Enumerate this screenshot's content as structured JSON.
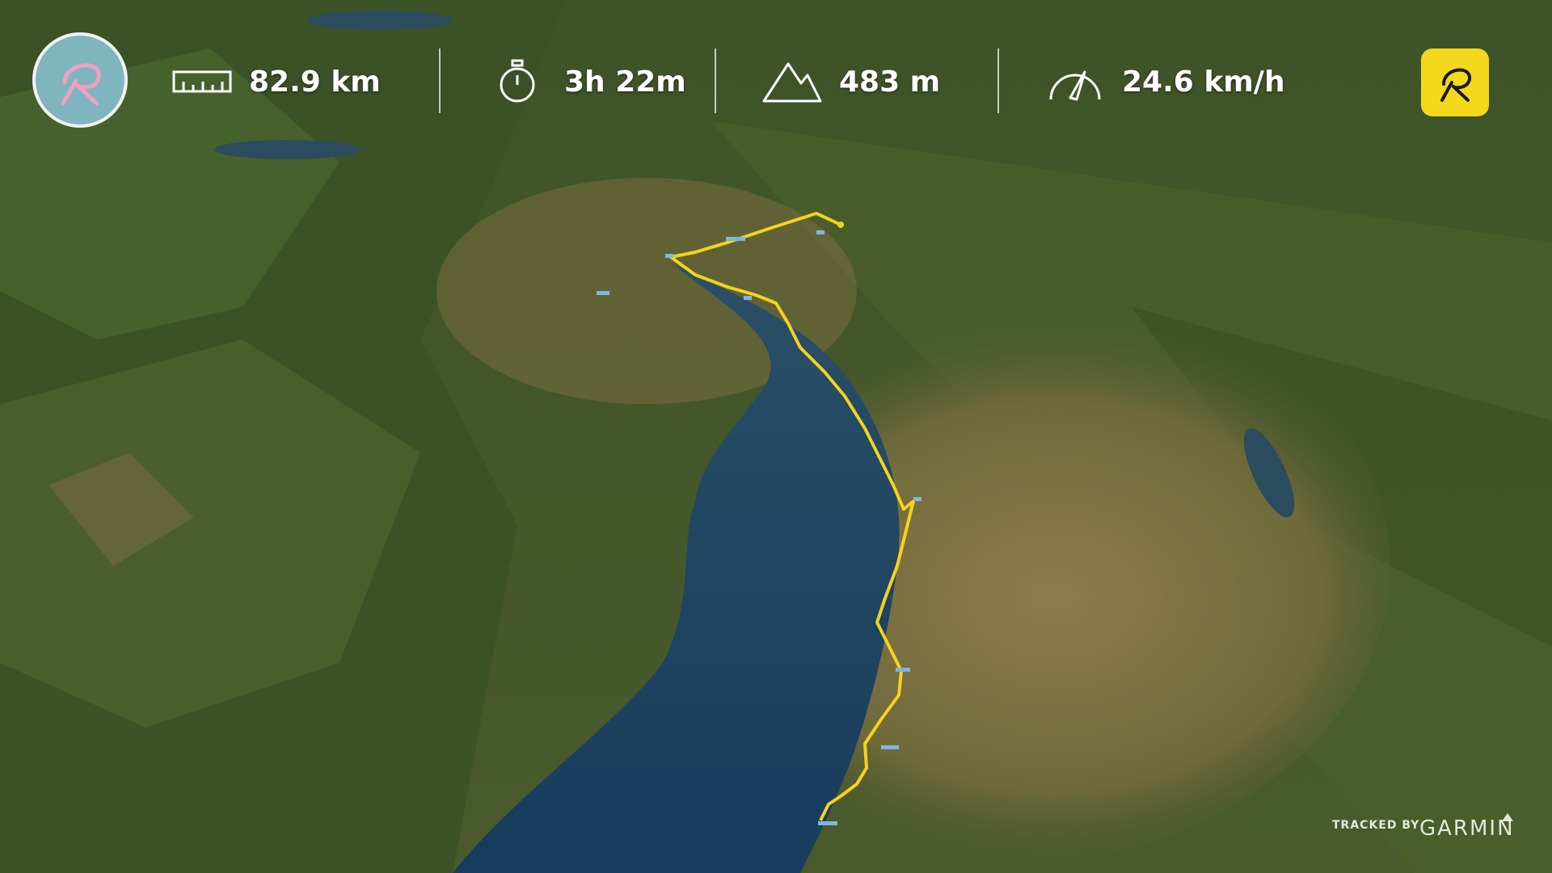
{
  "stats": {
    "distance": "82.9 km",
    "duration": "3h 22m",
    "elevation": "483 m",
    "speed": "24.6 km/h"
  },
  "icons": {
    "profile": "relive-logo-icon",
    "distance": "ruler-icon",
    "duration": "stopwatch-icon",
    "elevation": "mountain-icon",
    "speed": "speedometer-icon",
    "brand": "relive-brand-icon"
  },
  "footer": {
    "tracked_by": "TRACKED BY",
    "provider": "GARMIN"
  },
  "colors": {
    "route": "#f5d21e",
    "brand": "#f4d81c",
    "avatar": "#7fb5bf",
    "lake": "#1d4466",
    "terrain_green": "#3f5a28",
    "farmland": "#8b7a4a"
  }
}
